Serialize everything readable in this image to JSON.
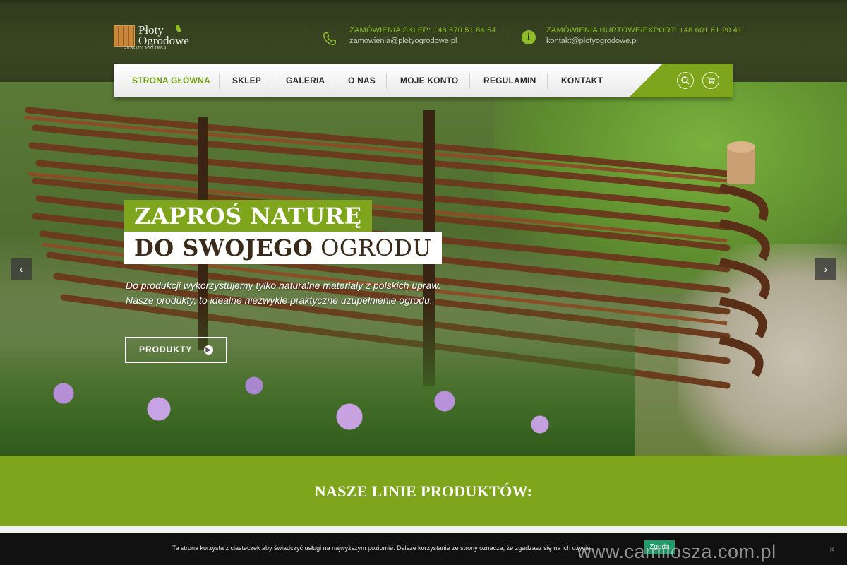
{
  "brand": {
    "name_line1": "Płoty",
    "name_line2": "Ogrodowe",
    "tagline": "QUALITY MATTERS"
  },
  "contacts": [
    {
      "label": "ZAMÓWIENIA SKLEP: +48 570 51 84 54",
      "email": "zamowienia@plotyogrodowe.pl",
      "icon": "phone-icon"
    },
    {
      "label": "ZAMÓWIENIA HURTOWE/EXPORT: +48 601 61 20 41",
      "email": "kontakt@plotyogrodowe.pl",
      "icon": "info-icon"
    }
  ],
  "nav": {
    "items": [
      {
        "label": "STRONA GŁÓWNA",
        "active": true
      },
      {
        "label": "SKLEP"
      },
      {
        "label": "GALERIA"
      },
      {
        "label": "O NAS"
      },
      {
        "label": "MOJE KONTO"
      },
      {
        "label": "REGULAMIN"
      },
      {
        "label": "KONTAKT"
      }
    ],
    "icons": [
      "search-icon",
      "cart-icon"
    ]
  },
  "hero": {
    "title1": "ZAPROŚ NATURĘ",
    "title2_bold": "DO SWOJEGO",
    "title2_light": "OGRODU",
    "text_line1": "Do produkcji wykorzystujemy tylko naturalne materiały z polskich upraw.",
    "text_line2": "Nasze produkty, to idealne niezwykle praktyczne uzupełnienie ogrodu.",
    "button": "PRODUKTY",
    "prev_arrow": "‹",
    "next_arrow": "›"
  },
  "products_section": {
    "title": "NASZE LINIE PRODUKTÓW:"
  },
  "cookie": {
    "text": "Ta strona korzysta z ciasteczek aby świadczyć usługi na najwyższym poziomie. Dalsze korzystanie ze strony oznacza, że zgadzasz się na ich użycie.",
    "accept": "Zgoda",
    "close": "×"
  },
  "watermark": "www.camilosza.com.pl",
  "colors": {
    "accent": "#7ea51c",
    "header_bg": "#34401f",
    "cookie_bg": "#111111",
    "cookie_button": "#1f9c6a"
  }
}
